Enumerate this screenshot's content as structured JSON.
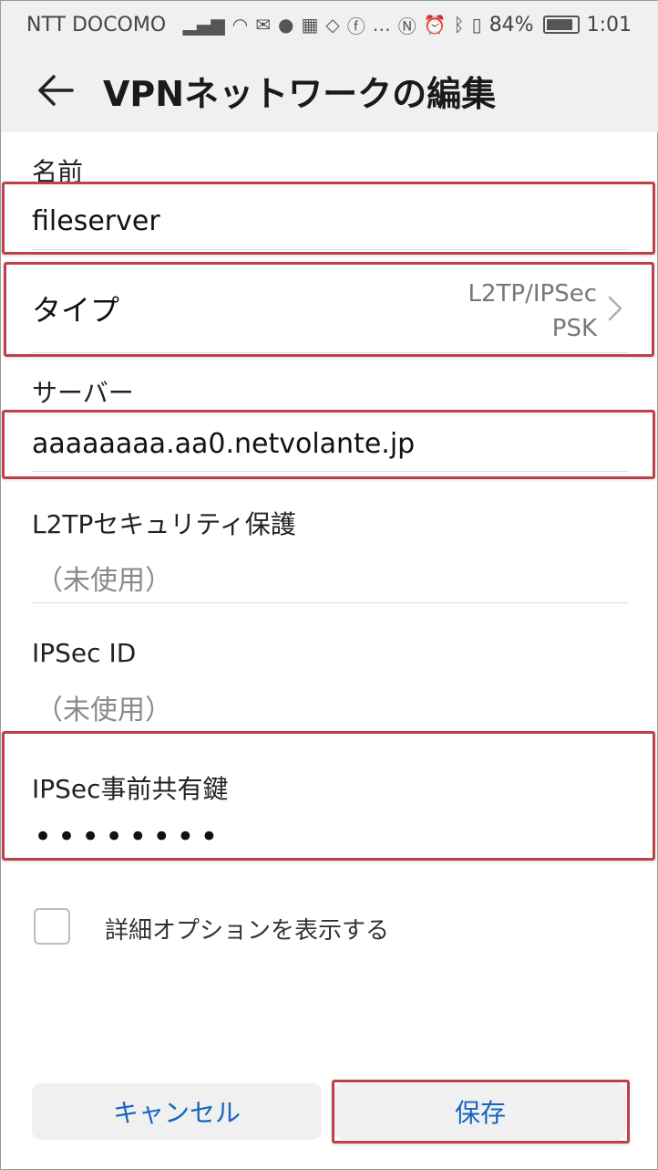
{
  "status_bar": {
    "carrier": "NTT DOCOMO",
    "battery": "84%",
    "time": "1:01"
  },
  "header": {
    "title": "VPNネットワークの編集"
  },
  "form": {
    "name_label": "名前",
    "name_value": "fileserver",
    "type_label": "タイプ",
    "type_value_line1": "L2TP/IPSec",
    "type_value_line2": "PSK",
    "server_label": "サーバー",
    "server_value": "aaaaaaaa.aa0.netvolante.jp",
    "l2tp_secret_label": "L2TPセキュリティ保護",
    "l2tp_secret_placeholder": "（未使用）",
    "ipsec_id_label": "IPSec ID",
    "ipsec_id_placeholder": "（未使用）",
    "psk_label": "IPSec事前共有鍵",
    "psk_value": "••••••••",
    "advanced_label": "詳細オプションを表示する"
  },
  "buttons": {
    "cancel": "キャンセル",
    "save": "保存"
  },
  "colors": {
    "highlight": "#c0404a",
    "accent": "#1565c0"
  }
}
